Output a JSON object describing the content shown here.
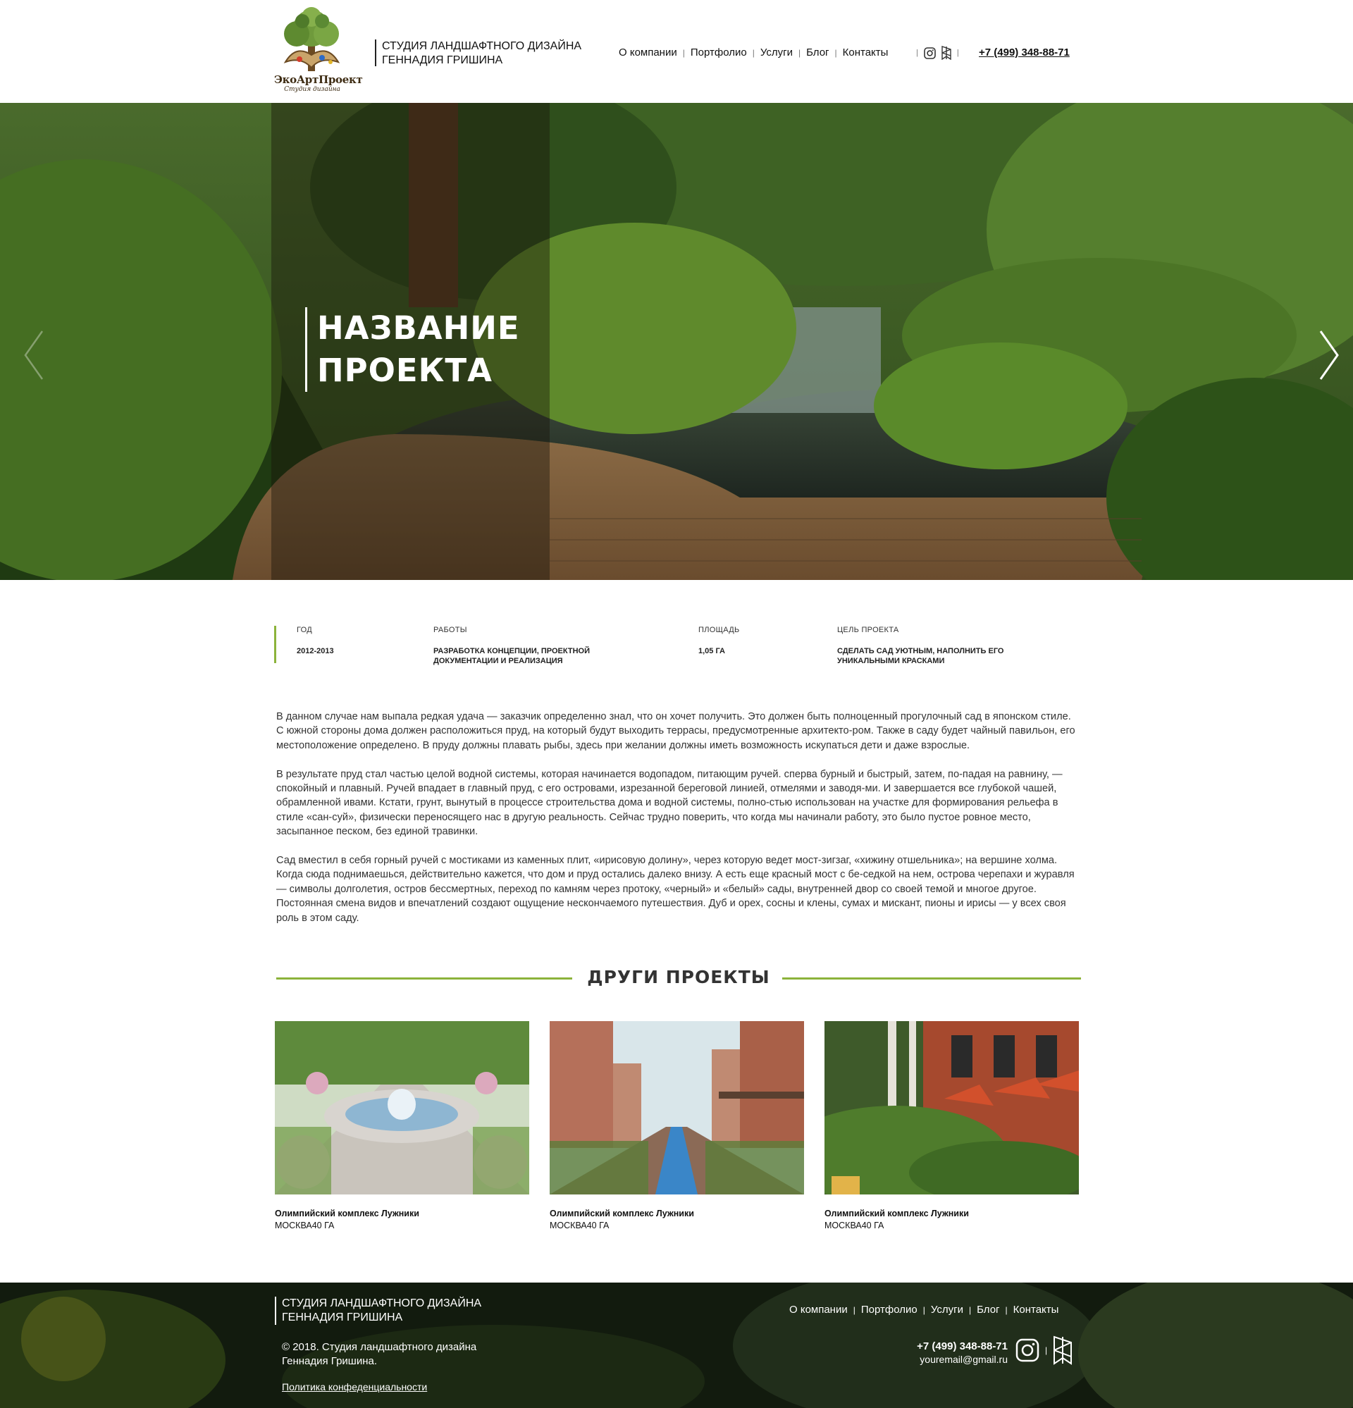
{
  "header": {
    "logo_text": "ЭкоАртПроект",
    "logo_sub": "Студия дизайна",
    "studio_line1": "СТУДИЯ ЛАНДШАФТНОГО ДИЗАЙНА",
    "studio_line2": "ГЕННАДИЯ ГРИШИНА",
    "nav": [
      "О компании",
      "Портфолио",
      "Услуги",
      "Блог",
      "Контакты"
    ],
    "icons": [
      "instagram-icon",
      "houzz-icon"
    ],
    "phone": "+7 (499) 348-88-71"
  },
  "hero": {
    "title_line1": "НАЗВАНИЕ",
    "title_line2": "ПРОЕКТА",
    "next_icon": "chevron-right-icon",
    "prev_icon": "chevron-left-icon"
  },
  "meta": {
    "year_label": "ГОД",
    "year_value": "2012-2013",
    "works_label": "РАБОТЫ",
    "works_value_1": "РАЗРАБОТКА КОНЦЕПЦИИ, ПРОЕКТНОЙ",
    "works_value_2": "ДОКУМЕНТАЦИИ И РЕАЛИЗАЦИЯ",
    "area_label": "ПЛОЩАДЬ",
    "area_value": "1,05 ГА",
    "goal_label": "ЦЕЛЬ ПРОЕКТА",
    "goal_value_1": "СДЕЛАТЬ САД УЮТНЫМ, НАПОЛНИТЬ ЕГО",
    "goal_value_2": "УНИКАЛЬНЫМИ КРАСКАМИ"
  },
  "article": {
    "p1": "В данном случае нам выпала редкая удача — заказчик определенно знал, что он хочет получить. Это должен быть полноценный прогулочный сад в японском стиле. С южной стороны дома должен расположиться пруд, на который будут выходить террасы, предусмотренные архитекто-ром. Также в саду будет чайный павильон, его местоположение определено. В пруду должны плавать рыбы, здесь при желании должны иметь возможность искупаться дети и даже взрослые.",
    "p2": "В результате пруд стал частью целой водной системы, которая начинается водопадом, питающим ручей. сперва бурный и быстрый, затем, по-падая на равнину, — спокойный и плавный. Ручей впадает в главный пруд, с его островами, изрезанной береговой линией, отмелями и заводя-ми. И завершается все глубокой чашей, обрамленной ивами. Кстати, грунт, вынутый в процессе строительства дома и водной системы, полно-стью использован на участке для формирования рельефа в стиле «сан-суй», физически переносящего нас в другую реальность. Сейчас трудно поверить, что когда мы начинали работу, это было пустое ровное место, засыпанное песком, без единой травинки.",
    "p3": "Сад вместил в себя горный ручей с мостиками из каменных плит, «ирисовую долину», через которую ведет мост-зигзаг, «хижину отшельника»; на вершине холма. Когда сюда поднимаешься, действительно кажется, что дом и пруд остались далеко внизу. А есть еще красный мост с бе-седкой на нем, острова черепахи и журавля — символы долголетия, остров бессмертных, переход по камням через протоку, «черный» и «белый» сады, внутренней двор со своей темой и многое другое. Постоянная смена видов и впечатлений создают ощущение нескончаемого путешествия. Дуб и орех, сосны и клены, сумах и мискант, пионы и ирисы — у всех своя роль в этом саду."
  },
  "other": {
    "title": "ДРУГИ ПРОЕКТЫ",
    "cards": [
      {
        "name": "Олимпийский комплекс Лужники",
        "meta": "МОСКВА40 ГА"
      },
      {
        "name": "Олимпийский комплекс Лужники",
        "meta": "МОСКВА40 ГА"
      },
      {
        "name": "Олимпийский комплекс Лужники",
        "meta": "МОСКВА40 ГА"
      }
    ]
  },
  "footer": {
    "studio_line1": "СТУДИЯ ЛАНДШАФТНОГО ДИЗАЙНА",
    "studio_line2": "ГЕННАДИЯ ГРИШИНА",
    "copy_line1": "© 2018. Студия ландшафтного дизайна",
    "copy_line2": "Геннадия Гришина.",
    "policy": "Политика конфеденциальности",
    "nav": [
      "О компании",
      "Портфолио",
      "Услуги",
      "Блог",
      "Контакты"
    ],
    "phone": "+7 (499) 348-88-71",
    "email": "youremail@gmail.ru",
    "icons": [
      "instagram-icon",
      "houzz-icon"
    ]
  },
  "colors": {
    "accent": "#8cb33b",
    "text": "#333333"
  }
}
